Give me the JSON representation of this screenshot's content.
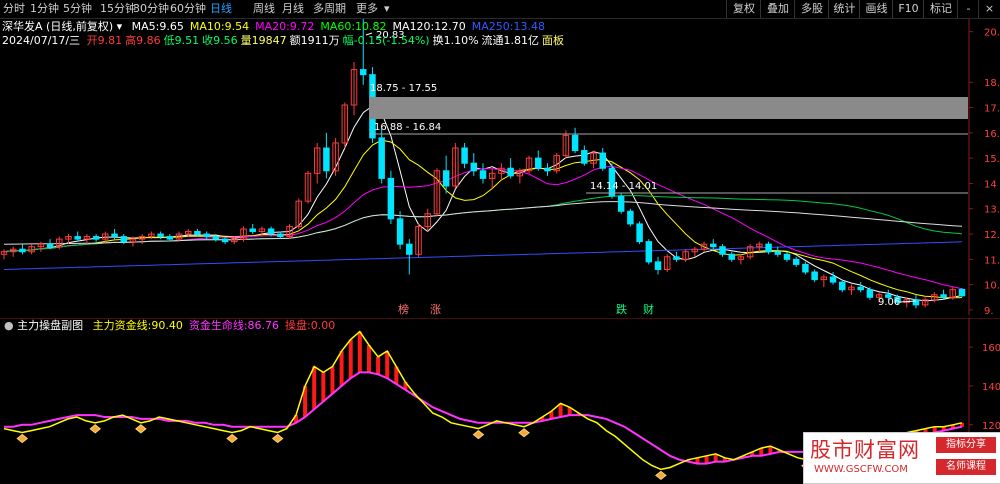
{
  "toolbar": {
    "timeframes": [
      "分时",
      "1分钟",
      "5分钟",
      "15分钟",
      "30分钟",
      "60分钟",
      "日线",
      "周线",
      "月线",
      "多周期",
      "更多"
    ],
    "active_timeframe": "日线",
    "buttons": [
      "复权",
      "叠加",
      "多股",
      "统计",
      "画线",
      "F10",
      "标记"
    ],
    "window_controls": [
      "-",
      "×"
    ]
  },
  "header": {
    "stock_name": "深华发A",
    "mode": "(日线,前复权)",
    "ma": [
      {
        "label": "MA5:",
        "value": "9.65",
        "color": "#ffffff"
      },
      {
        "label": "MA10:",
        "value": "9.54",
        "color": "#ffff00"
      },
      {
        "label": "MA20:",
        "value": "9.72",
        "color": "#ff00ff"
      },
      {
        "label": "MA60:",
        "value": "10.82",
        "color": "#00ff00"
      },
      {
        "label": "MA120:",
        "value": "12.70",
        "color": "#ffffff"
      },
      {
        "label": "MA250:",
        "value": "13.48",
        "color": "#2f5bff"
      }
    ],
    "date": "2024/07/17/三",
    "quote": [
      {
        "label": "开",
        "value": "9.81",
        "color": "#ff3b3b"
      },
      {
        "label": "高",
        "value": "9.86",
        "color": "#ff3b3b"
      },
      {
        "label": "低",
        "value": "9.51",
        "color": "#00ff66"
      },
      {
        "label": "收",
        "value": "9.56",
        "color": "#00ff66"
      },
      {
        "label": "量",
        "value": "19847",
        "color": "#ffff66"
      },
      {
        "label": "额",
        "value": "1911万",
        "color": "#ffffff"
      },
      {
        "label": "幅",
        "value": "-0.15(-1.54%)",
        "color": "#00ff66"
      },
      {
        "label": "换",
        "value": "1.10%",
        "color": "#ffffff"
      },
      {
        "label": "流通",
        "value": "1.81亿",
        "color": "#ffffff"
      },
      {
        "label": "",
        "value": "面板",
        "color": "#ffff66"
      }
    ]
  },
  "annotations": {
    "high_label": "20.83",
    "low_label": "9.06",
    "range1": "18.75 - 17.55",
    "range2": "16.88 - 16.84",
    "range3": "14.14 - 14.01",
    "tag_bang_1": "榜",
    "tag_zhang": "涨",
    "tag_bang_2": "跌",
    "tag_cai": "财"
  },
  "sub_header": {
    "title": "主力操盘副图",
    "items": [
      {
        "label": "主力资金线:",
        "value": "90.40",
        "color": "#ffff00"
      },
      {
        "label": "资金生命线:",
        "value": "86.76",
        "color": "#ff33ff"
      },
      {
        "label": "操盘:",
        "value": "0.00",
        "color": "#ff3b3b"
      }
    ]
  },
  "watermark": {
    "title": "股市财富网",
    "url": "WWW.GSCFW.COM",
    "tag1": "指标分享",
    "tag2": "名师课程"
  },
  "chart_data": [
    {
      "type": "candlestick",
      "ylim": [
        8.8,
        20.5
      ],
      "y_ticks": [
        9,
        10,
        11,
        12,
        13,
        14,
        15,
        16,
        17,
        18,
        20
      ],
      "y_tick_labels": [
        "9.",
        "10.",
        "11.",
        "12.",
        "13.",
        "14",
        "15.",
        "16.",
        "17.",
        "18.",
        "20."
      ],
      "candles": [
        [
          11.2,
          11.4,
          11.0,
          11.3
        ],
        [
          11.3,
          11.5,
          11.1,
          11.4
        ],
        [
          11.4,
          11.6,
          11.2,
          11.3
        ],
        [
          11.3,
          11.6,
          11.2,
          11.5
        ],
        [
          11.5,
          11.7,
          11.3,
          11.6
        ],
        [
          11.6,
          11.8,
          11.4,
          11.5
        ],
        [
          11.5,
          11.9,
          11.4,
          11.8
        ],
        [
          11.8,
          12.0,
          11.6,
          11.9
        ],
        [
          11.9,
          12.1,
          11.7,
          11.8
        ],
        [
          11.8,
          12.0,
          11.6,
          11.9
        ],
        [
          11.9,
          12.0,
          11.7,
          11.8
        ],
        [
          11.8,
          12.1,
          11.7,
          12.0
        ],
        [
          12.0,
          12.2,
          11.8,
          11.9
        ],
        [
          11.9,
          12.0,
          11.6,
          11.7
        ],
        [
          11.7,
          11.9,
          11.5,
          11.8
        ],
        [
          11.8,
          12.0,
          11.6,
          11.9
        ],
        [
          11.9,
          12.1,
          11.8,
          12.0
        ],
        [
          12.0,
          12.1,
          11.8,
          11.9
        ],
        [
          11.9,
          12.0,
          11.7,
          11.8
        ],
        [
          11.8,
          12.1,
          11.7,
          12.0
        ],
        [
          12.0,
          12.2,
          11.9,
          12.1
        ],
        [
          12.1,
          12.2,
          11.9,
          12.0
        ],
        [
          12.0,
          12.1,
          11.8,
          11.9
        ],
        [
          11.9,
          12.0,
          11.7,
          11.8
        ],
        [
          11.8,
          11.9,
          11.6,
          11.7
        ],
        [
          11.7,
          11.9,
          11.6,
          11.8
        ],
        [
          11.8,
          12.3,
          11.7,
          12.2
        ],
        [
          12.2,
          12.4,
          12.0,
          12.1
        ],
        [
          12.1,
          12.3,
          11.9,
          12.2
        ],
        [
          12.2,
          12.3,
          11.9,
          12.0
        ],
        [
          12.0,
          12.1,
          11.8,
          11.9
        ],
        [
          11.9,
          12.4,
          11.8,
          12.3
        ],
        [
          12.3,
          13.4,
          12.2,
          13.3
        ],
        [
          13.3,
          14.5,
          13.2,
          14.4
        ],
        [
          14.4,
          15.6,
          14.0,
          15.4
        ],
        [
          15.4,
          16.0,
          14.2,
          14.5
        ],
        [
          14.5,
          15.8,
          14.3,
          15.6
        ],
        [
          15.6,
          17.2,
          15.4,
          17.1
        ],
        [
          17.1,
          18.8,
          16.7,
          18.5
        ],
        [
          18.5,
          20.83,
          17.9,
          18.3
        ],
        [
          18.3,
          18.6,
          15.6,
          15.8
        ],
        [
          15.8,
          16.2,
          14.0,
          14.2
        ],
        [
          14.2,
          14.5,
          12.4,
          12.6
        ],
        [
          12.6,
          12.9,
          11.4,
          11.6
        ],
        [
          11.6,
          11.8,
          10.4,
          11.2
        ],
        [
          11.2,
          12.4,
          11.1,
          12.3
        ],
        [
          12.3,
          13.0,
          12.1,
          12.8
        ],
        [
          12.8,
          14.6,
          12.7,
          14.5
        ],
        [
          14.5,
          15.1,
          13.6,
          13.9
        ],
        [
          13.9,
          15.6,
          13.8,
          15.4
        ],
        [
          15.4,
          15.6,
          14.6,
          14.8
        ],
        [
          14.8,
          15.2,
          14.3,
          14.5
        ],
        [
          14.5,
          14.8,
          14.0,
          14.2
        ],
        [
          14.2,
          14.6,
          13.8,
          14.4
        ],
        [
          14.4,
          14.8,
          14.1,
          14.6
        ],
        [
          14.6,
          15.0,
          14.2,
          14.3
        ],
        [
          14.3,
          14.6,
          14.0,
          14.5
        ],
        [
          14.5,
          15.1,
          14.4,
          15.0
        ],
        [
          15.0,
          15.3,
          14.5,
          14.6
        ],
        [
          14.6,
          14.8,
          14.3,
          14.5
        ],
        [
          14.5,
          15.2,
          14.4,
          15.1
        ],
        [
          15.1,
          16.1,
          15.0,
          15.9
        ],
        [
          15.9,
          16.2,
          15.2,
          15.3
        ],
        [
          15.3,
          15.5,
          14.7,
          14.8
        ],
        [
          14.8,
          15.3,
          14.6,
          15.2
        ],
        [
          15.2,
          15.4,
          14.5,
          14.6
        ],
        [
          14.6,
          14.8,
          13.4,
          13.5
        ],
        [
          13.5,
          13.6,
          12.8,
          12.9
        ],
        [
          12.9,
          13.0,
          12.3,
          12.4
        ],
        [
          12.4,
          12.5,
          11.6,
          11.7
        ],
        [
          11.7,
          11.8,
          10.8,
          10.9
        ],
        [
          10.9,
          11.1,
          10.4,
          10.6
        ],
        [
          10.6,
          11.2,
          10.5,
          11.1
        ],
        [
          11.1,
          11.3,
          10.9,
          11.0
        ],
        [
          11.0,
          11.4,
          10.9,
          11.3
        ],
        [
          11.3,
          11.5,
          11.1,
          11.4
        ],
        [
          11.4,
          11.7,
          11.3,
          11.6
        ],
        [
          11.6,
          11.8,
          11.4,
          11.5
        ],
        [
          11.5,
          11.6,
          11.1,
          11.2
        ],
        [
          11.2,
          11.3,
          10.9,
          11.0
        ],
        [
          11.0,
          11.2,
          10.8,
          11.1
        ],
        [
          11.1,
          11.6,
          11.0,
          11.5
        ],
        [
          11.5,
          11.7,
          11.3,
          11.6
        ],
        [
          11.6,
          11.7,
          11.2,
          11.3
        ],
        [
          11.3,
          11.5,
          11.1,
          11.2
        ],
        [
          11.2,
          11.3,
          10.9,
          11.0
        ],
        [
          11.0,
          11.1,
          10.7,
          10.8
        ],
        [
          10.8,
          10.9,
          10.4,
          10.5
        ],
        [
          10.5,
          10.6,
          10.1,
          10.2
        ],
        [
          10.2,
          10.4,
          9.9,
          10.3
        ],
        [
          10.3,
          10.5,
          10.0,
          10.1
        ],
        [
          10.1,
          10.2,
          9.7,
          9.8
        ],
        [
          9.8,
          10.0,
          9.6,
          9.9
        ],
        [
          9.9,
          10.1,
          9.7,
          9.8
        ],
        [
          9.8,
          9.9,
          9.4,
          9.5
        ],
        [
          9.5,
          9.7,
          9.3,
          9.6
        ],
        [
          9.6,
          9.8,
          9.4,
          9.5
        ],
        [
          9.5,
          9.6,
          9.2,
          9.3
        ],
        [
          9.3,
          9.5,
          9.1,
          9.4
        ],
        [
          9.4,
          9.6,
          9.06,
          9.2
        ],
        [
          9.2,
          9.5,
          9.1,
          9.4
        ],
        [
          9.4,
          9.7,
          9.3,
          9.6
        ],
        [
          9.6,
          9.8,
          9.4,
          9.5
        ],
        [
          9.5,
          9.9,
          9.4,
          9.8
        ],
        [
          9.81,
          9.86,
          9.51,
          9.56
        ]
      ]
    },
    {
      "type": "line",
      "ylim": [
        90,
        175
      ],
      "y_ticks": [
        100,
        120,
        140,
        160
      ],
      "y_tick_labels": [
        "100",
        "120",
        "140",
        "160"
      ],
      "series": [
        {
          "name": "主力资金线",
          "color": "#ffff00",
          "values": [
            118,
            117,
            116,
            117,
            118,
            119,
            121,
            123,
            124,
            122,
            121,
            122,
            124,
            125,
            123,
            121,
            122,
            124,
            123,
            122,
            121,
            120,
            119,
            118,
            117,
            116,
            117,
            119,
            118,
            117,
            116,
            118,
            125,
            140,
            150,
            147,
            150,
            158,
            164,
            168,
            161,
            155,
            158,
            150,
            142,
            136,
            131,
            126,
            124,
            121,
            120,
            119,
            118,
            120,
            122,
            121,
            120,
            119,
            121,
            124,
            127,
            131,
            129,
            126,
            123,
            121,
            117,
            114,
            110,
            106,
            102,
            99,
            97,
            98,
            100,
            102,
            103,
            104,
            105,
            103,
            102,
            104,
            106,
            108,
            109,
            107,
            105,
            103,
            102,
            103,
            105,
            107,
            108,
            110,
            112,
            111,
            110,
            112,
            114,
            116,
            117,
            118,
            119,
            119,
            120,
            121
          ]
        },
        {
          "name": "资金生命线",
          "color": "#ff33ff",
          "values": [
            119,
            119,
            120,
            120,
            121,
            122,
            123,
            124,
            125,
            125,
            125,
            124,
            124,
            124,
            124,
            123,
            123,
            123,
            122,
            122,
            122,
            121,
            121,
            120,
            120,
            119,
            119,
            119,
            119,
            119,
            119,
            119,
            121,
            124,
            128,
            132,
            136,
            140,
            144,
            147,
            147,
            146,
            144,
            141,
            138,
            135,
            132,
            129,
            127,
            125,
            123,
            122,
            121,
            121,
            121,
            121,
            121,
            121,
            121,
            122,
            123,
            124,
            125,
            125,
            125,
            124,
            123,
            121,
            119,
            116,
            113,
            110,
            107,
            104,
            102,
            101,
            100,
            100,
            101,
            101,
            102,
            103,
            104,
            104,
            105,
            106,
            106,
            106,
            106,
            106,
            107,
            107,
            108,
            109,
            109,
            110,
            111,
            112,
            112,
            113,
            114,
            115,
            116,
            117,
            118,
            119
          ]
        }
      ]
    }
  ]
}
